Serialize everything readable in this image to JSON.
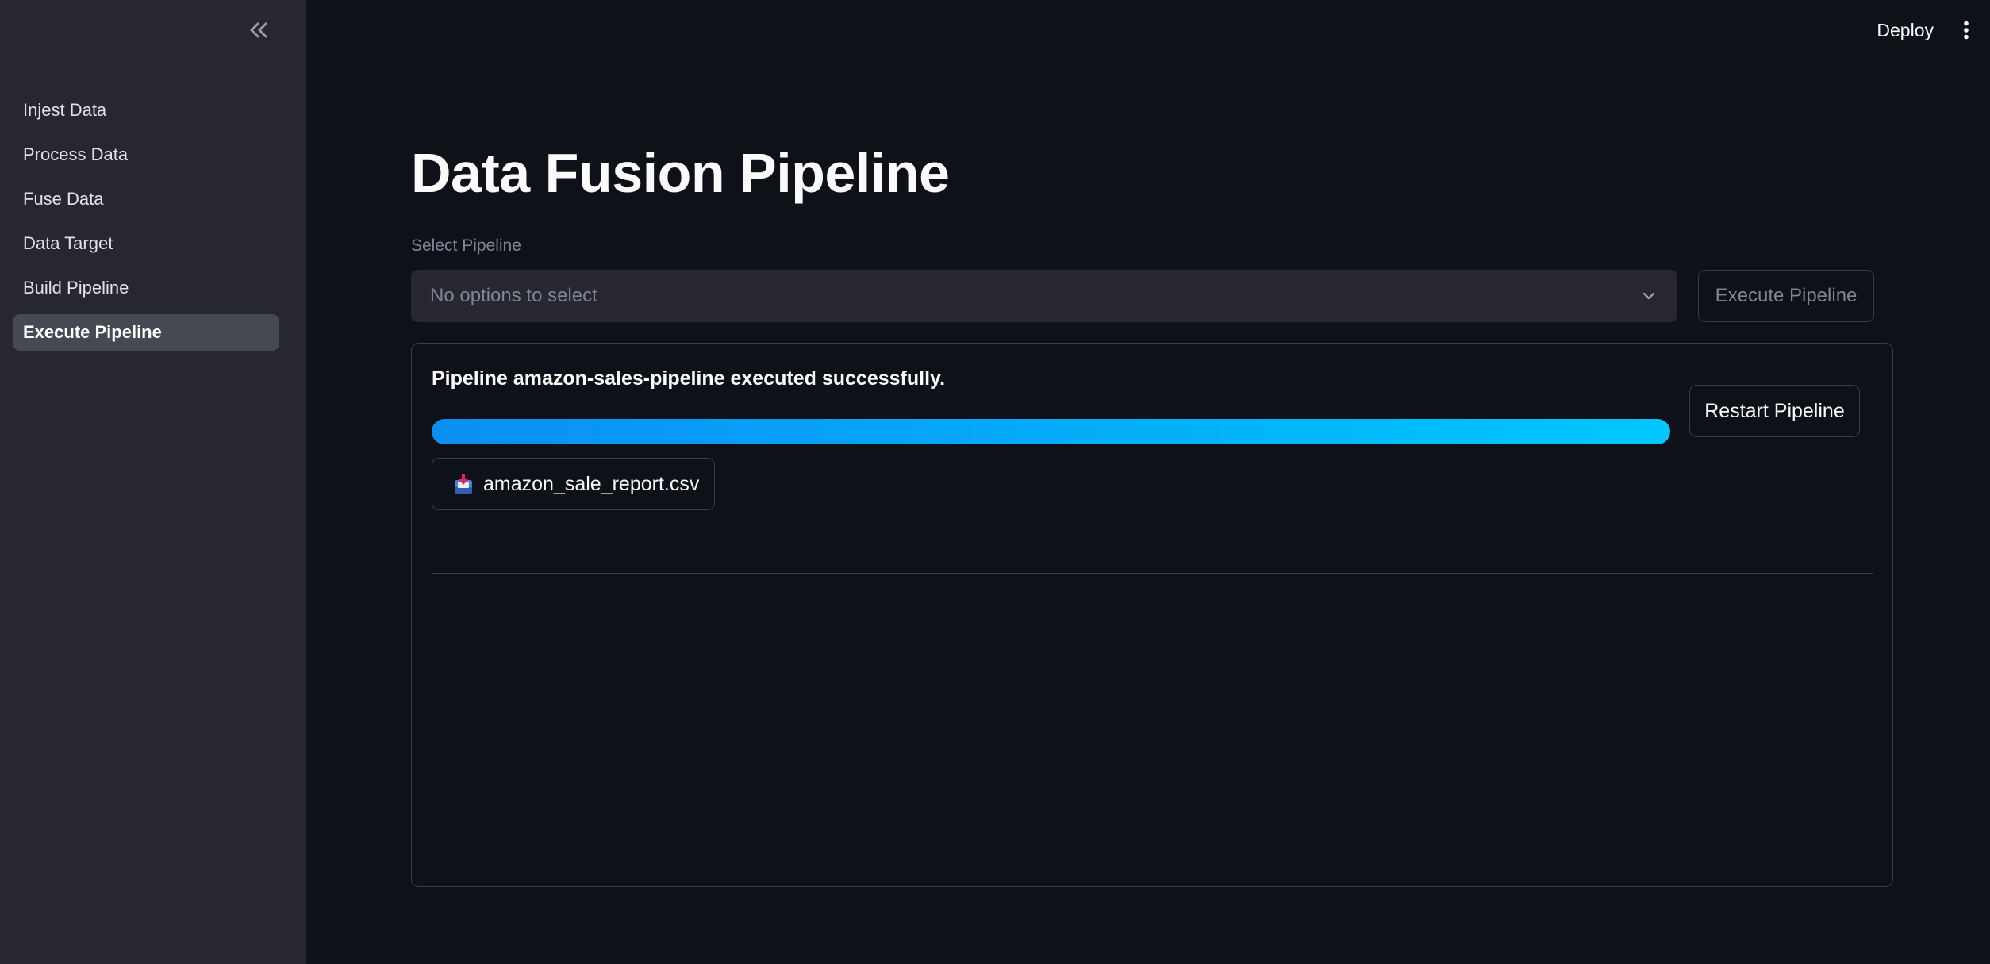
{
  "sidebar": {
    "collapse_icon": "double-chevron-left-icon",
    "items": [
      {
        "label": "Injest Data",
        "active": false
      },
      {
        "label": "Process Data",
        "active": false
      },
      {
        "label": "Fuse Data",
        "active": false
      },
      {
        "label": "Data Target",
        "active": false
      },
      {
        "label": "Build Pipeline",
        "active": false
      },
      {
        "label": "Execute Pipeline",
        "active": true
      }
    ]
  },
  "header": {
    "deploy_label": "Deploy",
    "menu_icon": "kebab-menu-icon"
  },
  "main": {
    "title": "Data Fusion Pipeline",
    "select": {
      "label": "Select Pipeline",
      "placeholder": "No options to select",
      "chevron_icon": "chevron-down-icon"
    },
    "execute_button_label": "Execute Pipeline",
    "result": {
      "message": "Pipeline amazon-sales-pipeline executed successfully.",
      "progress": 1.0,
      "restart_button_label": "Restart Pipeline",
      "file": {
        "icon": "inbox-tray-icon",
        "name": "amazon_sale_report.csv"
      }
    }
  },
  "colors": {
    "background": "#0e1117",
    "sidebar": "#262730",
    "progress_start": "#0a8ff3",
    "progress_end": "#00c7fd"
  }
}
